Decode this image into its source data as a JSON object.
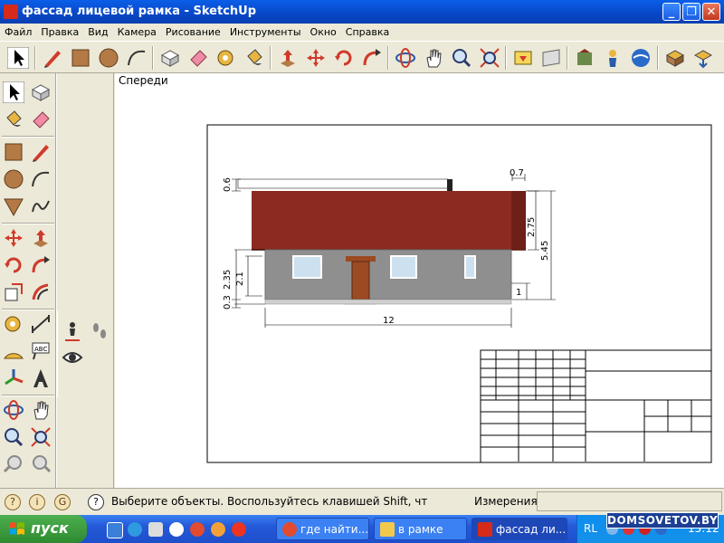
{
  "window": {
    "title": "фассад лицевой рамка - SketchUp"
  },
  "menu": [
    "Файл",
    "Правка",
    "Вид",
    "Камера",
    "Рисование",
    "Инструменты",
    "Окно",
    "Справка"
  ],
  "scene": {
    "label": "Спереди"
  },
  "drawing": {
    "dimensions": {
      "roof_overhang_top": "0.6",
      "chimney_offset": "0.7",
      "roof_height": "2.75",
      "total_height": "5.45",
      "wall_height": "2.35",
      "window_height": "2.1",
      "plinth": "0.3",
      "step": "1",
      "width": "12"
    },
    "colors": {
      "roof": "#8b2a20",
      "wall": "#8f8f8f",
      "door": "#9b4a22",
      "window": "#cde0ef",
      "frame": "#000000"
    }
  },
  "status": {
    "hint": "Выберите объекты. Воспользуйтесь клавишей Shift, чт",
    "measure_label": "Измерения",
    "measure_value": ""
  },
  "taskbar": {
    "start": "пуск",
    "tasks": [
      {
        "label": "где найти...",
        "icon": "chrome-icon",
        "color": "#e24b2f"
      },
      {
        "label": "в рамке",
        "icon": "folder-icon",
        "color": "#f2c94c"
      },
      {
        "label": "фассад ли...",
        "icon": "sketchup-icon",
        "color": "#d62a1a"
      }
    ],
    "lang": "RL",
    "clock": "15:12"
  },
  "watermark": "DOMSOVETOV.BY"
}
